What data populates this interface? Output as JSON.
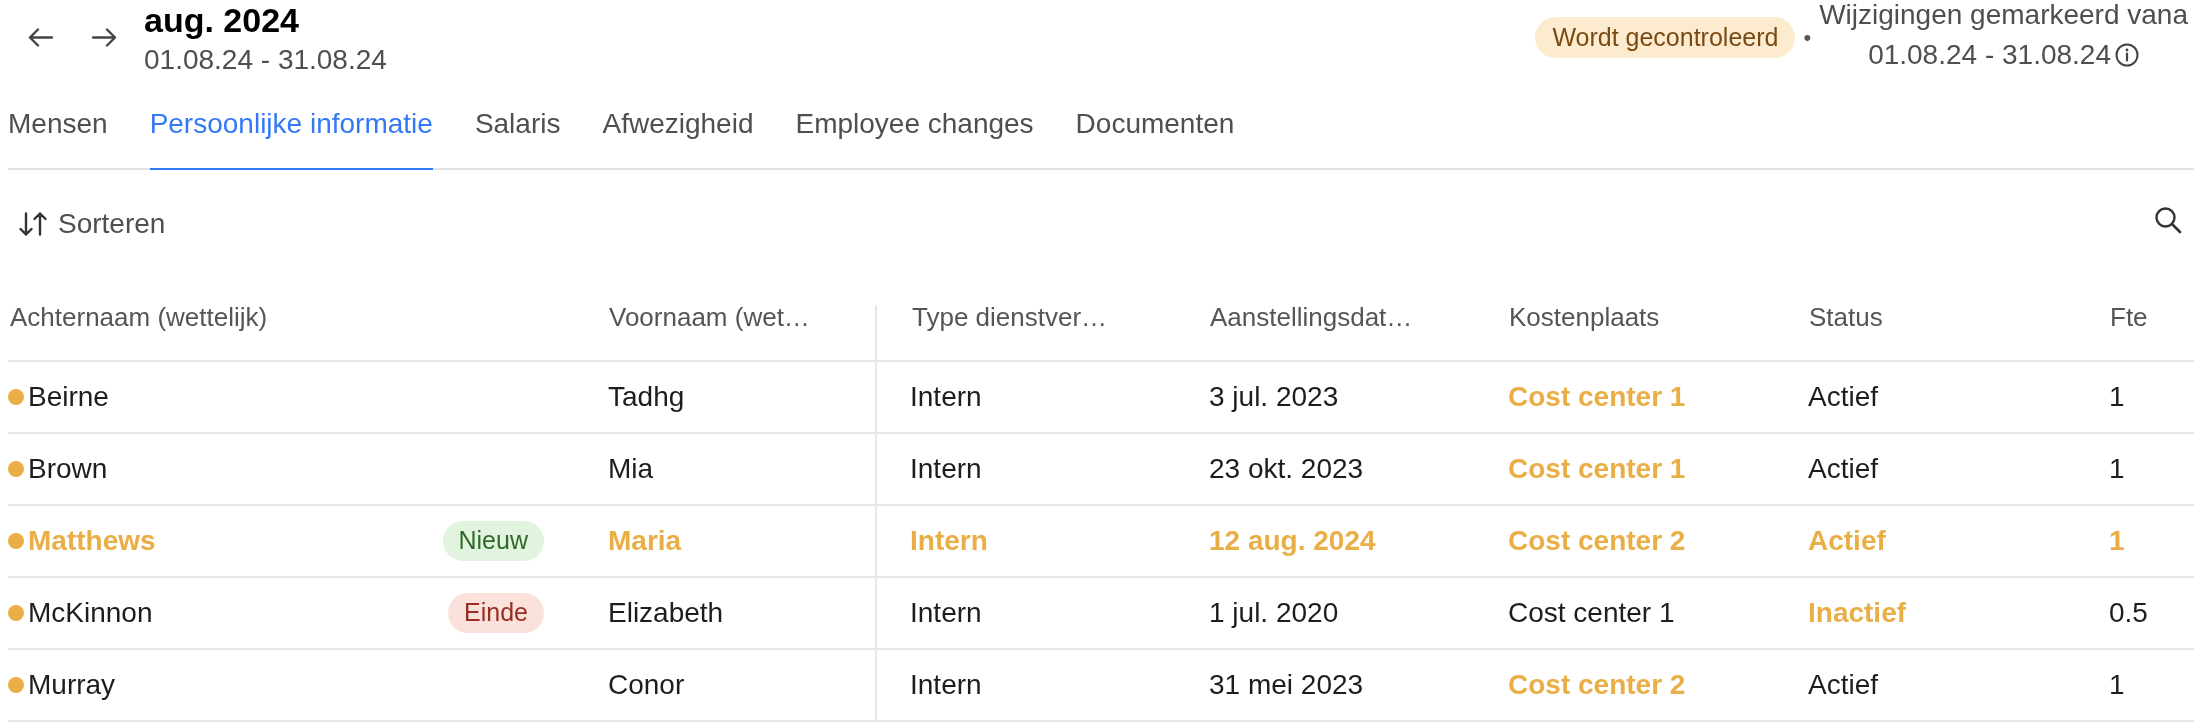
{
  "period": {
    "title": "aug. 2024",
    "range": "01.08.24 - 31.08.24"
  },
  "review": {
    "status": "Wordt gecontroleerd",
    "separator": "•",
    "changes_label": "Wijzigingen gemarkeerd vana",
    "changes_range": "01.08.24 - 31.08.24"
  },
  "tabs": [
    {
      "label": "Mensen",
      "selected": false
    },
    {
      "label": "Persoonlijke informatie",
      "selected": true
    },
    {
      "label": "Salaris",
      "selected": false
    },
    {
      "label": "Afwezigheid",
      "selected": false
    },
    {
      "label": "Employee changes",
      "selected": false
    },
    {
      "label": "Documenten",
      "selected": false
    }
  ],
  "toolbar": {
    "sort_label": "Sorteren"
  },
  "table": {
    "columns": [
      "Achternaam (wettelijk)",
      "Voornaam (wet…",
      "Type dienstver…",
      "Aanstellingsdat…",
      "Kostenplaats",
      "Status",
      "Fte"
    ],
    "rows": [
      {
        "marked": true,
        "cells": [
          {
            "text": "Beirne",
            "changed": false
          },
          {
            "text": "Tadhg",
            "changed": false
          },
          {
            "text": "Intern",
            "changed": false
          },
          {
            "text": "3 jul. 2023",
            "changed": false
          },
          {
            "text": "Cost center 1",
            "changed": true
          },
          {
            "text": "Actief",
            "changed": false
          },
          {
            "text": "1",
            "changed": false
          }
        ]
      },
      {
        "marked": true,
        "cells": [
          {
            "text": "Brown",
            "changed": false
          },
          {
            "text": "Mia",
            "changed": false
          },
          {
            "text": "Intern",
            "changed": false
          },
          {
            "text": "23 okt. 2023",
            "changed": false
          },
          {
            "text": "Cost center 1",
            "changed": true
          },
          {
            "text": "Actief",
            "changed": false
          },
          {
            "text": "1",
            "changed": false
          }
        ]
      },
      {
        "marked": true,
        "badge": {
          "text": "Nieuw",
          "kind": "new"
        },
        "cells": [
          {
            "text": "Matthews",
            "changed": true
          },
          {
            "text": "Maria",
            "changed": true
          },
          {
            "text": "Intern",
            "changed": true
          },
          {
            "text": "12 aug. 2024",
            "changed": true
          },
          {
            "text": "Cost center 2",
            "changed": true
          },
          {
            "text": "Actief",
            "changed": true
          },
          {
            "text": "1",
            "changed": true
          }
        ]
      },
      {
        "marked": true,
        "badge": {
          "text": "Einde",
          "kind": "end"
        },
        "cells": [
          {
            "text": "McKinnon",
            "changed": false
          },
          {
            "text": "Elizabeth",
            "changed": false
          },
          {
            "text": "Intern",
            "changed": false
          },
          {
            "text": "1 jul. 2020",
            "changed": false
          },
          {
            "text": "Cost center 1",
            "changed": false
          },
          {
            "text": "Inactief",
            "changed": true
          },
          {
            "text": "0.5",
            "changed": false
          }
        ]
      },
      {
        "marked": true,
        "cells": [
          {
            "text": "Murray",
            "changed": false
          },
          {
            "text": "Conor",
            "changed": false
          },
          {
            "text": "Intern",
            "changed": false
          },
          {
            "text": "31 mei 2023",
            "changed": false
          },
          {
            "text": "Cost center 2",
            "changed": true
          },
          {
            "text": "Actief",
            "changed": false
          },
          {
            "text": "1",
            "changed": false
          }
        ]
      }
    ]
  }
}
